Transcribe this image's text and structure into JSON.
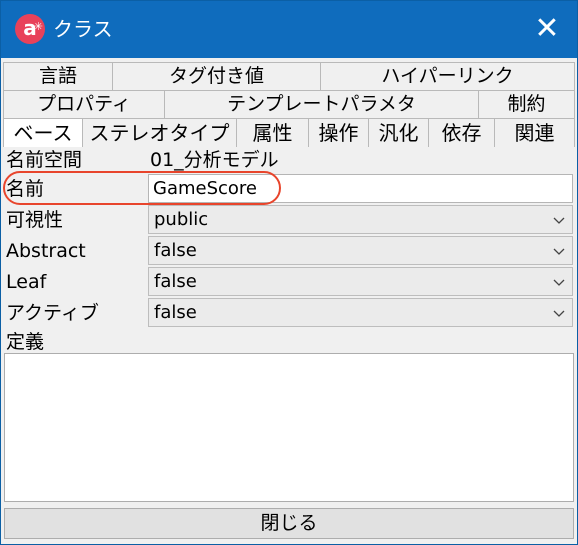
{
  "window": {
    "title": "クラス",
    "close_label": "✕"
  },
  "tabs": {
    "row1": [
      "言語",
      "タグ付き値",
      "ハイパーリンク"
    ],
    "row2": [
      "プロパティ",
      "テンプレートパラメタ",
      "制約"
    ],
    "row3": [
      "ベース",
      "ステレオタイプ",
      "属性",
      "操作",
      "汎化",
      "依存",
      "関連"
    ],
    "active": "ベース"
  },
  "form": {
    "namespace_label": "名前空間",
    "namespace_value": "01_分析モデル",
    "name_label": "名前",
    "name_value": "GameScore",
    "visibility_label": "可視性",
    "visibility_value": "public",
    "abstract_label": "Abstract",
    "abstract_value": "false",
    "leaf_label": "Leaf",
    "leaf_value": "false",
    "active_label": "アクティブ",
    "active_value": "false",
    "definition_label": "定義",
    "definition_value": ""
  },
  "footer": {
    "close_button_label": "閉じる"
  },
  "colors": {
    "titlebar": "#0f6cbd",
    "highlight": "#e8452c"
  }
}
